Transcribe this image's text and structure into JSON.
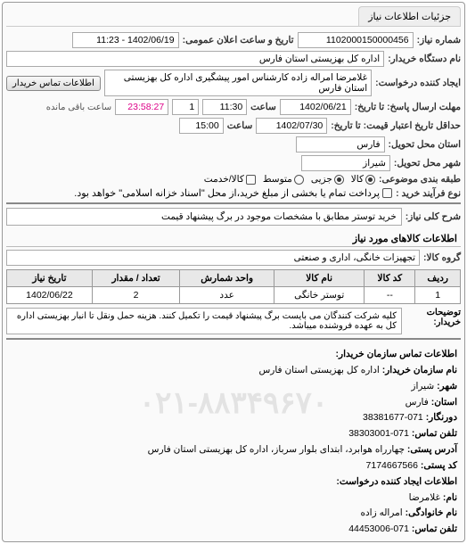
{
  "tab": {
    "title": "جزئیات اطلاعات نیاز"
  },
  "header": {
    "req_number_label": "شماره نیاز:",
    "req_number": "1102000150000456",
    "announce_label": "تاریخ و ساعت اعلان عمومی:",
    "announce_value": "1402/06/19 - 11:23",
    "org_label": "نام دستگاه خریدار:",
    "org_value": "اداره کل بهزیستی استان فارس",
    "creator_label": "ایجاد کننده درخواست:",
    "creator_value": "غلامرضا امراله زاده کارشناس امور پیشگیری اداره کل بهزیستی استان فارس",
    "contact_btn": "اطلاعات تماس خریدار",
    "deadline_reply_label": "مهلت ارسال پاسخ: تا تاریخ:",
    "deadline_reply_date": "1402/06/21",
    "deadline_time_label": "ساعت",
    "deadline_reply_time": "11:30",
    "days": "1",
    "countdown": "23:58:27",
    "remain": "ساعت باقی مانده",
    "validity_label": "حداقل تاریخ اعتبار قیمت: تا تاریخ:",
    "validity_date": "1402/07/30",
    "validity_time": "15:00",
    "province_label": "استان محل تحویل:",
    "province": "فارس",
    "city_label": "شهر محل تحویل:",
    "city": "شیراز",
    "class_label": "طبقه بندی موضوعی:",
    "class_opt1": "کالا",
    "class_opt2": "جزیی",
    "class_opt3": "متوسط",
    "class_opt4": "کالا/خدمت",
    "process_label": "نوع فرآیند خرید :",
    "process_text": "پرداخت تمام یا بخشی از مبلغ خرید،از محل \"اسناد خزانه اسلامی\" خواهد بود."
  },
  "need": {
    "title_label": "شرح کلی نیاز:",
    "title_value": "خرید توستر مطابق با مشخصات موجود در برگ پیشنهاد قیمت"
  },
  "goods": {
    "section": "اطلاعات کالاهای مورد نیاز",
    "group_label": "گروه کالا:",
    "group_value": "تجهیزات خانگی، اداری و صنعتی",
    "columns": {
      "row": "ردیف",
      "code": "کد کالا",
      "name": "نام کالا",
      "unit": "واحد شمارش",
      "qty": "تعداد / مقدار",
      "date": "تاریخ نیاز"
    },
    "rows": [
      {
        "row": "1",
        "code": "--",
        "name": "توستر خانگی",
        "unit": "عدد",
        "qty": "2",
        "date": "1402/06/22"
      }
    ]
  },
  "explain": {
    "buyer_label": "توضیحات خریدار:",
    "buyer_text": "کلیه شرکت کنندگان می بایست برگ پیشنهاد قیمت را تکمیل کنند. هزینه حمل ونقل تا انبار بهزیستی اداره کل به عهده فروشنده میباشد."
  },
  "contact": {
    "section": "اطلاعات تماس سازمان خریدار:",
    "org_name_label": "نام سازمان خریدار:",
    "org_name": "اداره کل بهزیستی استان فارس",
    "city_label": "شهر:",
    "city": "شیراز",
    "province_label": "استان:",
    "province": "فارس",
    "fax_label": "دورنگار:",
    "fax": "071-38381677",
    "phone_label": "تلفن تماس:",
    "phone": "071-38303001",
    "address_label": "آدرس پستی:",
    "address": "چهارراه هوابرد، ابتدای بلوار سرباز، اداره کل بهزیستی استان فارس",
    "zip_label": "کد پستی:",
    "zip": "7174667566",
    "creator_section": "اطلاعات ایجاد کننده درخواست:",
    "name_label": "نام:",
    "name": "غلامرضا",
    "surname_label": "نام خانوادگی:",
    "surname": "امراله زاده",
    "tel_label": "تلفن تماس:",
    "tel": "071-44453006"
  },
  "watermark": "۰۲۱-۸۸۳۴۹۶۷۰"
}
